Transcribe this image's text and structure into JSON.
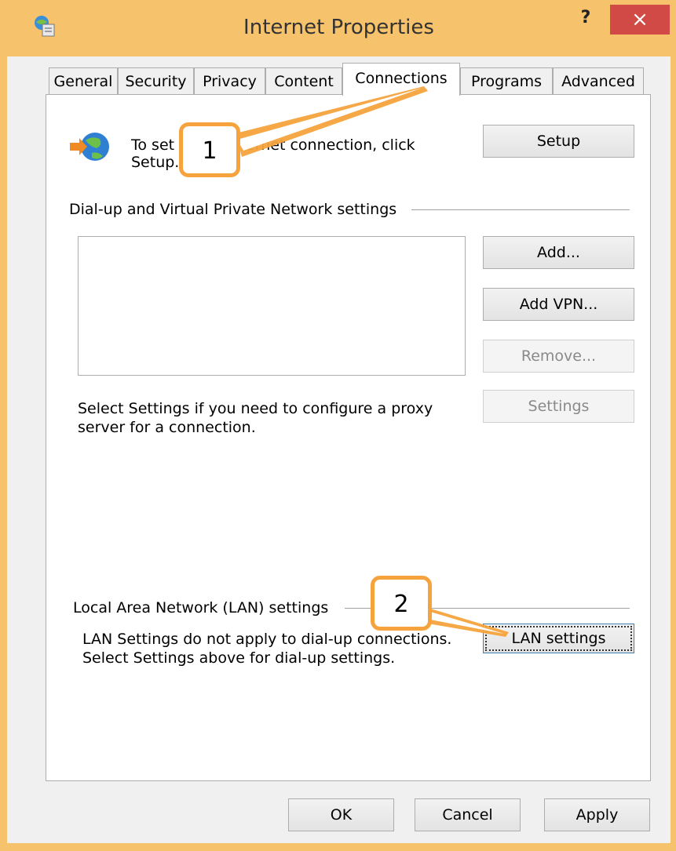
{
  "window": {
    "title": "Internet Properties",
    "help_label": "?",
    "close_label": "×"
  },
  "tabs": [
    {
      "label": "General"
    },
    {
      "label": "Security"
    },
    {
      "label": "Privacy"
    },
    {
      "label": "Content"
    },
    {
      "label": "Connections",
      "selected": true
    },
    {
      "label": "Programs"
    },
    {
      "label": "Advanced"
    }
  ],
  "setup": {
    "text_line1": "To set up an Internet connection, click",
    "text_line2": "Setup.",
    "button_label": "Setup"
  },
  "dialup": {
    "group_label": "Dial-up and Virtual Private Network settings",
    "add_label": "Add...",
    "add_vpn_label": "Add VPN...",
    "remove_label": "Remove...",
    "settings_label": "Settings",
    "proxy_text_line1": "Select Settings if you need to configure a proxy",
    "proxy_text_line2": "server for a connection."
  },
  "lan": {
    "group_label": "Local Area Network (LAN) settings",
    "text_line1": "LAN Settings do not apply to dial-up connections.",
    "text_line2": "Select Settings above for dial-up settings.",
    "button_label": "LAN settings"
  },
  "footer": {
    "ok_label": "OK",
    "cancel_label": "Cancel",
    "apply_label": "Apply"
  },
  "annotations": {
    "callout_1": "1",
    "callout_2": "2"
  },
  "colors": {
    "frame": "#f6c36c",
    "close": "#d24a45",
    "callout_border": "#f6a33d"
  }
}
